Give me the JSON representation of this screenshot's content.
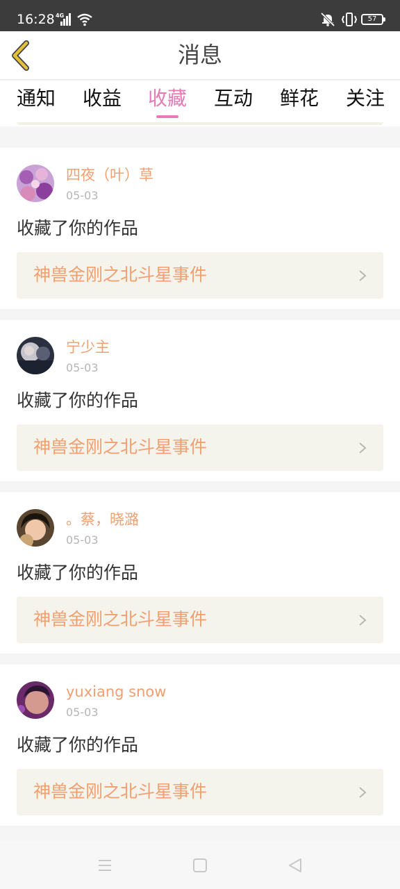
{
  "status_bar": {
    "time": "16:28",
    "network": "4G",
    "battery": "57",
    "icons": [
      "signal-icon",
      "wifi-icon",
      "mute-icon",
      "vibrate-icon",
      "battery-icon"
    ]
  },
  "nav": {
    "title": "消息",
    "back_icon": "chevron-left-icon"
  },
  "tabs": [
    {
      "label": "通知",
      "active": false
    },
    {
      "label": "收益",
      "active": false
    },
    {
      "label": "收藏",
      "active": true
    },
    {
      "label": "互动",
      "active": false
    },
    {
      "label": "鲜花",
      "active": false
    },
    {
      "label": "关注",
      "active": false
    }
  ],
  "messages": [
    {
      "user": "四夜（叶）草",
      "date": "05-03",
      "action": "收藏了你的作品",
      "work": "神兽金刚之北斗星事件"
    },
    {
      "user": "宁少主",
      "date": "05-03",
      "action": "收藏了你的作品",
      "work": "神兽金刚之北斗星事件"
    },
    {
      "user": "。蔡，晓潞",
      "date": "05-03",
      "action": "收藏了你的作品",
      "work": "神兽金刚之北斗星事件"
    },
    {
      "user": "yuxiang snow",
      "date": "05-03",
      "action": "收藏了你的作品",
      "work": "神兽金刚之北斗星事件"
    }
  ],
  "colors": {
    "accent": "#e879b7",
    "name": "#f0a070",
    "status_bar": "#3c3c3c",
    "back_icon": "#e3c13a"
  },
  "system_nav": [
    "menu-icon",
    "home-icon",
    "back-icon"
  ]
}
